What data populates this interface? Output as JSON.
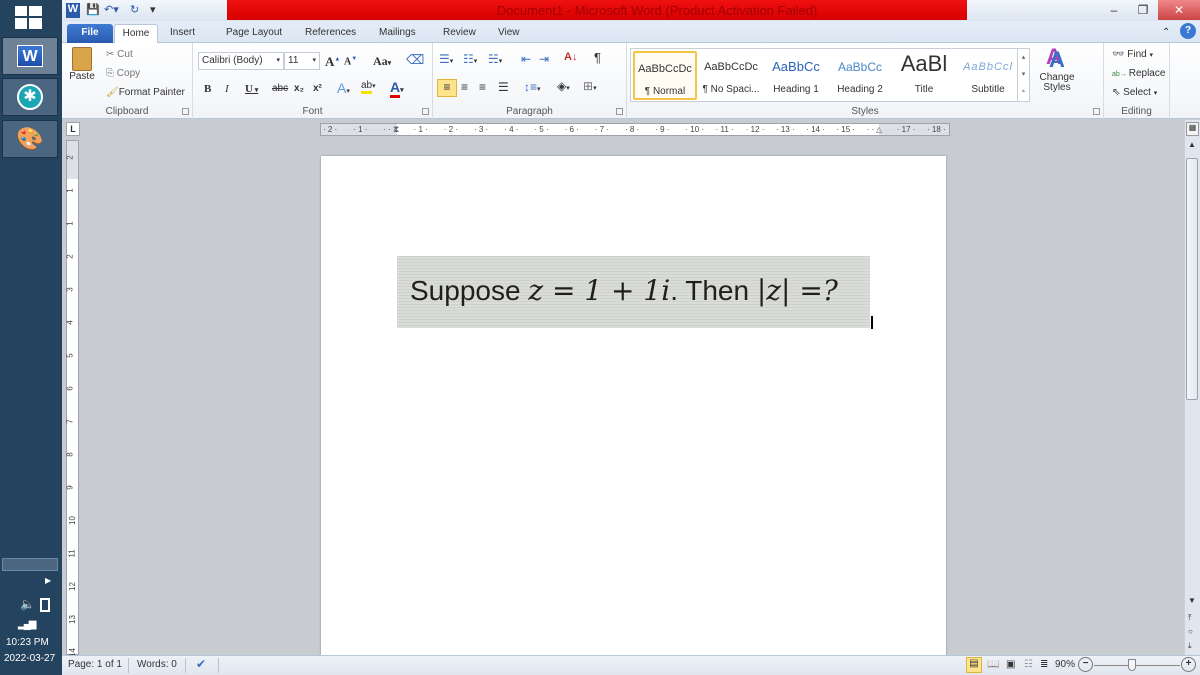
{
  "window": {
    "title": "Document1  -  Microsoft Word (Product Activation Failed)",
    "title_bar_color": "#e00000",
    "controls": {
      "minimize": "–",
      "restore": "❐",
      "close": "✕"
    }
  },
  "taskbar": {
    "apps": [
      {
        "name": "Microsoft Word",
        "icon": "word-icon"
      },
      {
        "name": "Accessibility",
        "icon": "accessibility-icon"
      },
      {
        "name": "Paint",
        "icon": "paint-palette-icon"
      }
    ],
    "clock": {
      "time": "10:23 PM",
      "date": "2022-03-27"
    }
  },
  "ribbon": {
    "tabs": [
      "File",
      "Home",
      "Insert",
      "Page Layout",
      "References",
      "Mailings",
      "Review",
      "View"
    ],
    "active_tab": "Home",
    "clipboard": {
      "paste": "Paste",
      "cut": "Cut",
      "copy": "Copy",
      "format_painter": "Format Painter",
      "label": "Clipboard"
    },
    "font": {
      "name": "Calibri (Body)",
      "size": "11",
      "label": "Font",
      "grow": "A",
      "shrink": "A",
      "change_case": "Aa",
      "bold": "B",
      "italic": "I",
      "underline": "U",
      "strike": "abc",
      "subscript": "x₂",
      "superscript": "x²",
      "highlight_color": "#f5e300",
      "font_color": "#e00000"
    },
    "paragraph": {
      "label": "Paragraph",
      "pilcrow": "¶"
    },
    "styles": {
      "label": "Styles",
      "items": [
        {
          "preview": "AaBbCcDc",
          "name": "¶ Normal",
          "selected": true
        },
        {
          "preview": "AaBbCcDc",
          "name": "¶ No Spaci...",
          "selected": false
        },
        {
          "preview": "AaBbCc",
          "name": "Heading 1",
          "selected": false
        },
        {
          "preview": "AaBbCc",
          "name": "Heading 2",
          "selected": false
        },
        {
          "preview": "AaBl",
          "name": "Title",
          "selected": false
        },
        {
          "preview": "AaBbCcl",
          "name": "Subtitle",
          "selected": false
        }
      ],
      "change_styles": "Change Styles"
    },
    "editing": {
      "label": "Editing",
      "find": "Find",
      "replace": "Replace",
      "select": "Select"
    }
  },
  "ruler": {
    "horizontal_ticks": [
      "2",
      "1",
      "",
      "1",
      "2",
      "3",
      "4",
      "5",
      "6",
      "7",
      "8",
      "9",
      "10",
      "11",
      "12",
      "13",
      "14",
      "15",
      "",
      "17",
      "18"
    ],
    "vertical_ticks": [
      "2",
      "1",
      "1",
      "2",
      "3",
      "4",
      "5",
      "6",
      "7",
      "8",
      "9",
      "10",
      "11",
      "12",
      "13",
      "14"
    ],
    "tab_selector": "L"
  },
  "document": {
    "equation_image": {
      "prefix": "Suppose ",
      "math1": "z = 1 + 1i",
      "mid": ". Then ",
      "math2": "|z| =?"
    }
  },
  "statusbar": {
    "page": "Page: 1 of 1",
    "words": "Words: 0",
    "zoom": "90%",
    "zoom_level_percent": 90
  }
}
